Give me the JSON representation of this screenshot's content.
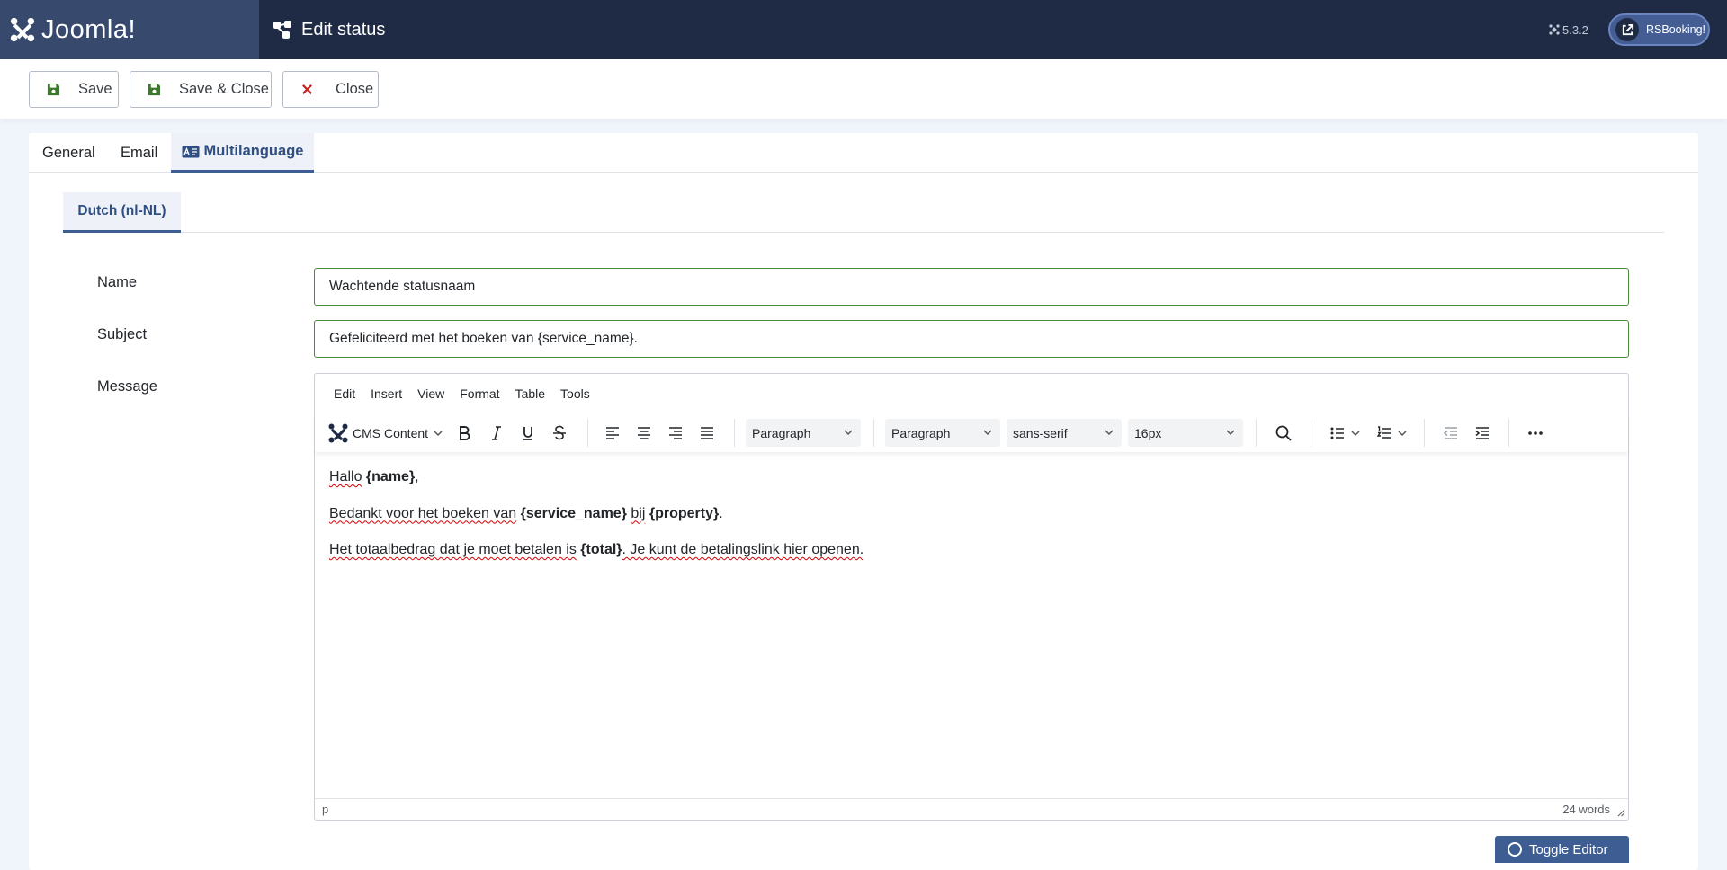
{
  "app": {
    "logo_text": "Joomla!",
    "page_title": "Edit status",
    "version": "5.3.2",
    "extension_button": "RSBooking!"
  },
  "toolbar": {
    "save_label": "Save",
    "save_close_label": "Save & Close",
    "close_label": "Close"
  },
  "tabs": [
    {
      "label": "General",
      "active": false
    },
    {
      "label": "Email",
      "active": false
    },
    {
      "label": "Multilanguage",
      "active": true
    }
  ],
  "subtabs": [
    {
      "label": "Dutch (nl-NL)",
      "active": true
    }
  ],
  "form": {
    "name_label": "Name",
    "name_value": "Wachtende statusnaam",
    "subject_label": "Subject",
    "subject_value": "Gefeliciteerd met het boeken van {service_name}.",
    "message_label": "Message"
  },
  "editor": {
    "menus": [
      "Edit",
      "Insert",
      "View",
      "Format",
      "Table",
      "Tools"
    ],
    "cms_content": "CMS Content",
    "block_format_1": "Paragraph",
    "block_format_2": "Paragraph",
    "font_family": "sans-serif",
    "font_size": "16px",
    "content": {
      "line1": {
        "pre": "Hallo",
        "bold": "{name}",
        "post": ","
      },
      "line2": {
        "a": "Bedankt voor het boeken van",
        "b": "{service_name}",
        "c": "bij",
        "d": "{property}",
        "e": "."
      },
      "line3": {
        "a": "Het totaalbedrag dat je moet betalen is",
        "b": "{total}",
        "c": ". Je kunt de betalingslink hier openen."
      }
    },
    "status_path": "p",
    "word_count": "24 words"
  },
  "footer": {
    "toggle_editor_label": "Toggle Editor"
  },
  "colors": {
    "header_bg": "#1f2b44",
    "logo_bg": "#374a6e",
    "accent": "#3e5e93",
    "valid_border": "#4d8b3f",
    "save_icon": "#3b7a2a",
    "close_icon": "#c52827"
  }
}
